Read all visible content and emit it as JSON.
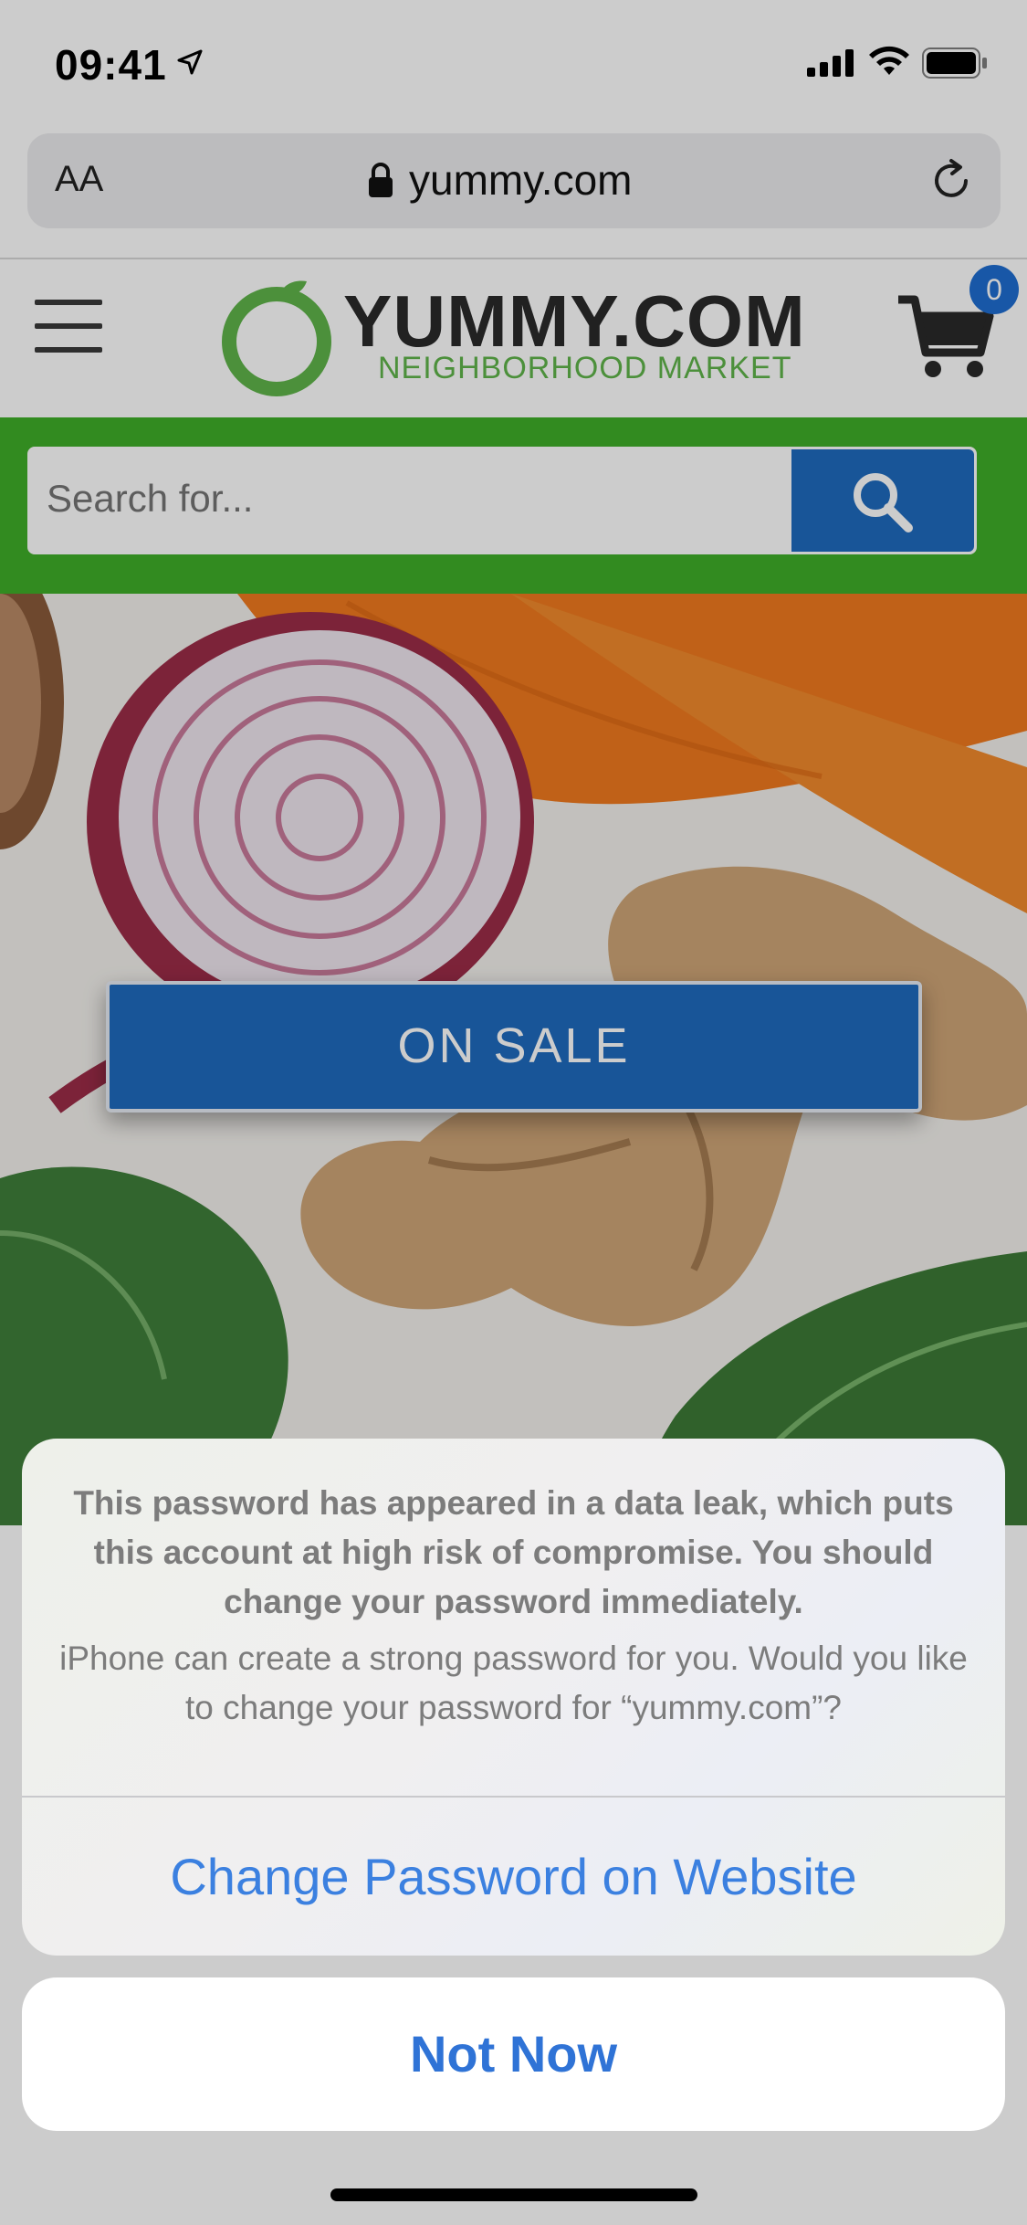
{
  "status_bar": {
    "time": "09:41"
  },
  "browser": {
    "text_size_label": "AA",
    "url": "yummy.com"
  },
  "site": {
    "logo_name": "YUMMY.COM",
    "logo_tagline": "NEIGHBORHOOD MARKET",
    "cart_count": "0",
    "search_placeholder": "Search for...",
    "hero_button": "ON SALE"
  },
  "sheet": {
    "message_bold": "This password has appeared in a data leak, which puts this account at high risk of compromise. You should change your password immediately.",
    "message_sub": "iPhone can create a strong password for you. Would you like to change your password for “yummy.com”?",
    "action_label": "Change Password on Website",
    "cancel_label": "Not Now"
  },
  "colors": {
    "brand_green": "#3fae29",
    "brand_blue": "#1f6bbf",
    "ios_link_blue": "#3b80e0"
  }
}
